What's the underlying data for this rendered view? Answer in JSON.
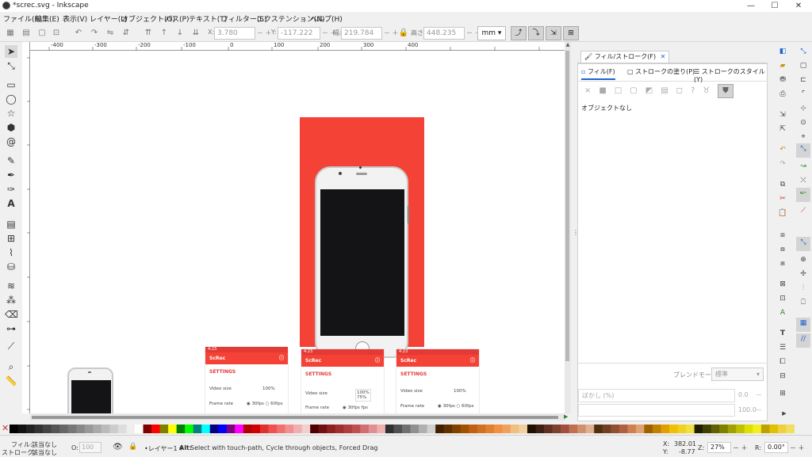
{
  "window": {
    "title": "*screc.svg - Inkscape",
    "min": "—",
    "max": "☐",
    "close": "✕"
  },
  "menu": [
    "ファイル(F)",
    "編集(E)",
    "表示(V)",
    "レイヤー(L)",
    "オブジェクト(O)",
    "パス(P)",
    "テキスト(T)",
    "フィルター(S)",
    "エクステンション(N)",
    "ヘルプ(H)"
  ],
  "toolctl": {
    "x_label": "X:",
    "x_value": "3.780",
    "y_label": "Y:",
    "y_value": "-117.222",
    "w_label": "幅:",
    "w_value": "219.784",
    "h_label": "高さ:",
    "h_value": "448.235",
    "unit": "mm ▾"
  },
  "ruler": {
    "top": [
      "-400",
      "-300",
      "-200",
      "-100",
      "0",
      "100",
      "200",
      "300",
      "400"
    ]
  },
  "canvas": {
    "colors": {
      "red": "#f44336",
      "status_red": "#e53935",
      "phone_screen": "#141316"
    },
    "cards": [
      {
        "time": "4:23",
        "app": "ScRec",
        "settings": "SETTINGS",
        "video_size": "Video size",
        "video_val": "100%",
        "frame_rate": "Frame rate",
        "fps1": "30fps",
        "fps2": "60fps"
      },
      {
        "time": "4:23",
        "app": "ScRec",
        "settings": "SETTINGS",
        "video_size": "Video size",
        "video_val": "100%",
        "frame_rate": "Frame rate",
        "fps1": "30fps",
        "fps2": "75%",
        "fps3": "fps"
      },
      {
        "time": "4:23",
        "app": "ScRec",
        "settings": "SETTINGS",
        "video_size": "Video size",
        "video_val": "100%",
        "frame_rate": "Frame rate",
        "fps1": "30fps",
        "fps2": "60fps"
      }
    ]
  },
  "panel": {
    "dock_tab": "フィル/ストローク(F)",
    "tabs": [
      "フィル(F)",
      "ストロークの塗り(P)",
      "ストロークのスタイル(Y)"
    ],
    "no_object": "オブジェクトなし",
    "blend_label": "ブレンドモード:",
    "blend_value": "標準",
    "blur_label": "ぼかし (%)",
    "blur_value": "0.0",
    "opacity_value": "100.0"
  },
  "status": {
    "fill_label": "フィル:",
    "fill_value": "該当なし",
    "stroke_label": "ストローク:",
    "stroke_value": "該当なし",
    "o_label": "O:",
    "o_value": "100",
    "layer": "•レイヤー1 ▾",
    "message_key": "Alt:",
    "message": "Select with touch-path, Cycle through objects, Forced Drag",
    "x_label": "X:",
    "x_value": "382.01",
    "y_label": "Y:",
    "y_value": "-8.77",
    "z_label": "Z:",
    "zoom": "27%",
    "r_label": "R:",
    "rotation": "0.00°"
  }
}
